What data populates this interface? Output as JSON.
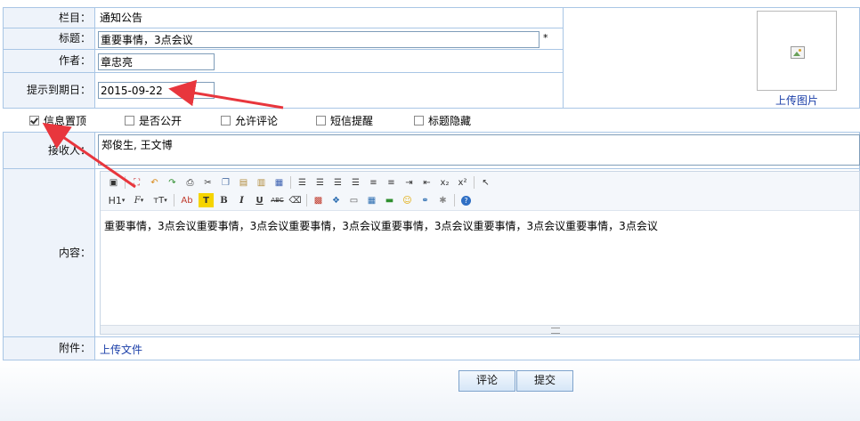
{
  "form": {
    "category_label": "栏目：",
    "category_value": "通知公告",
    "title_label": "标题：",
    "title_value": "重要事情，3点会议",
    "required_mark": "*",
    "author_label": "作者：",
    "author_value": "章忠亮",
    "expire_label": "提示到期日：",
    "expire_value": "2015-09-22",
    "upload_image_link": "上传图片",
    "options": [
      {
        "label": "信息置顶",
        "checked": true
      },
      {
        "label": "是否公开",
        "checked": false
      },
      {
        "label": "允许评论",
        "checked": false
      },
      {
        "label": "短信提醒",
        "checked": false
      },
      {
        "label": "标题隐藏",
        "checked": false
      }
    ],
    "recipients_label": "接收人：",
    "recipients_value": "郑俊生, 王文博",
    "content_label": "内容：",
    "content_value": "重要事情，3点会议重要事情，3点会议重要事情，3点会议重要事情，3点会议重要事情，3点会议重要事情，3点会议",
    "attachment_label": "附件：",
    "upload_file_link": "上传文件"
  },
  "editor": {
    "row2": {
      "h1": "H1",
      "font": "F",
      "size": "тT",
      "ab": "Ab",
      "bold": "B",
      "italic": "I",
      "underline": "U",
      "strike": "ABC"
    }
  },
  "buttons": {
    "comment": "评论",
    "submit": "提交"
  },
  "colors": {
    "border": "#a9c6e5",
    "label_bg": "#eef3fa",
    "arrow": "#e8363d",
    "link": "#1a3ea8"
  }
}
